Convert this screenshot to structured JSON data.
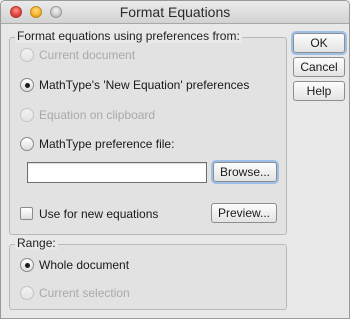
{
  "window": {
    "title": "Format Equations",
    "traffic_lights": [
      "close-icon",
      "minimize-icon",
      "zoom-icon"
    ]
  },
  "preferences_group": {
    "label": "Format equations using preferences from:",
    "options": [
      {
        "label": "Current document",
        "selected": false,
        "enabled": false
      },
      {
        "label": "MathType's 'New Equation' preferences",
        "selected": true,
        "enabled": true
      },
      {
        "label": "Equation on clipboard",
        "selected": false,
        "enabled": false
      },
      {
        "label": "MathType preference file:",
        "selected": false,
        "enabled": true
      }
    ],
    "file_path_value": "",
    "browse_label": "Browse...",
    "use_for_new_label": "Use for new equations",
    "use_for_new_checked": false,
    "preview_label": "Preview..."
  },
  "range_group": {
    "label": "Range:",
    "options": [
      {
        "label": "Whole document",
        "selected": true,
        "enabled": true
      },
      {
        "label": "Current selection",
        "selected": false,
        "enabled": false
      }
    ]
  },
  "buttons": {
    "ok_label": "OK",
    "cancel_label": "Cancel",
    "help_label": "Help"
  }
}
